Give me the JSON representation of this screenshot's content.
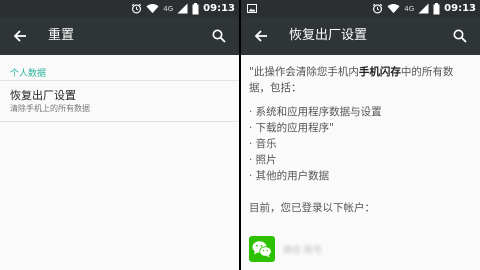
{
  "left_pane": {
    "status": {
      "time": "09:13",
      "network": "4G"
    },
    "appbar": {
      "title": "重置"
    },
    "section_header": "个人数据",
    "item": {
      "title": "恢复出厂设置",
      "summary": "清除手机上的所有数据"
    }
  },
  "right_pane": {
    "status": {
      "time": "09:13",
      "network": "4G"
    },
    "appbar": {
      "title": "恢复出厂设置"
    },
    "warning": {
      "line1_prefix": "\"此操作会清除您手机内",
      "line1_bold": "手机闪存",
      "line1_suffix": "中的所有数据，包括：",
      "bullets": [
        "· 系统和应用程序数据与设置",
        "· 下载的应用程序\"",
        "· 音乐",
        "· 照片",
        "· 其他的用户数据"
      ]
    },
    "accounts_label": "目前，您已登录以下帐户：",
    "account": {
      "name": "微信 账号"
    }
  },
  "colors": {
    "statusbar": "#2b2f31",
    "appbar": "#2f3436",
    "accent": "#2bb39f",
    "background": "#fafafa",
    "wechat_green": "#2dc100"
  }
}
